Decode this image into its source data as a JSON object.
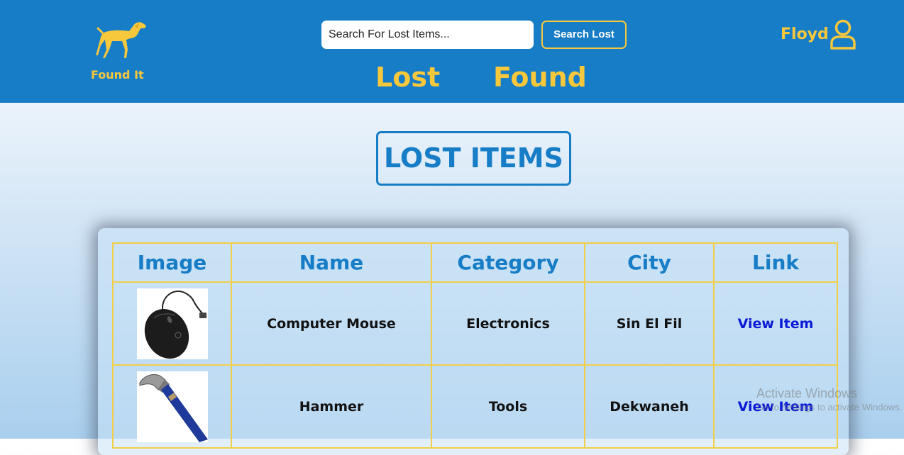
{
  "brand": {
    "name": "Found It"
  },
  "search": {
    "placeholder": "Search For Lost Items...",
    "button_label": "Search Lost"
  },
  "nav": {
    "lost": "Lost",
    "found": "Found"
  },
  "user": {
    "name": "Floyd"
  },
  "page": {
    "title": "LOST ITEMS"
  },
  "table": {
    "headers": [
      "Image",
      "Name",
      "Category",
      "City",
      "Link"
    ],
    "rows": [
      {
        "image": "computer-mouse-photo",
        "name": "Computer Mouse",
        "category": "Electronics",
        "city": "Sin El Fil",
        "link": "View Item"
      },
      {
        "image": "hammer-photo",
        "name": "Hammer",
        "category": "Tools",
        "city": "Dekwaneh",
        "link": "View Item"
      }
    ]
  },
  "watermark": {
    "title": "Activate Windows",
    "subtitle": "Go to Settings to activate Windows."
  },
  "colors": {
    "header_bg": "#167dc6",
    "accent": "#f7c73c",
    "link": "#0a1ad6",
    "border": "#f2cf48"
  },
  "icons": {
    "logo": "dog-logo-icon",
    "user": "user-icon"
  }
}
